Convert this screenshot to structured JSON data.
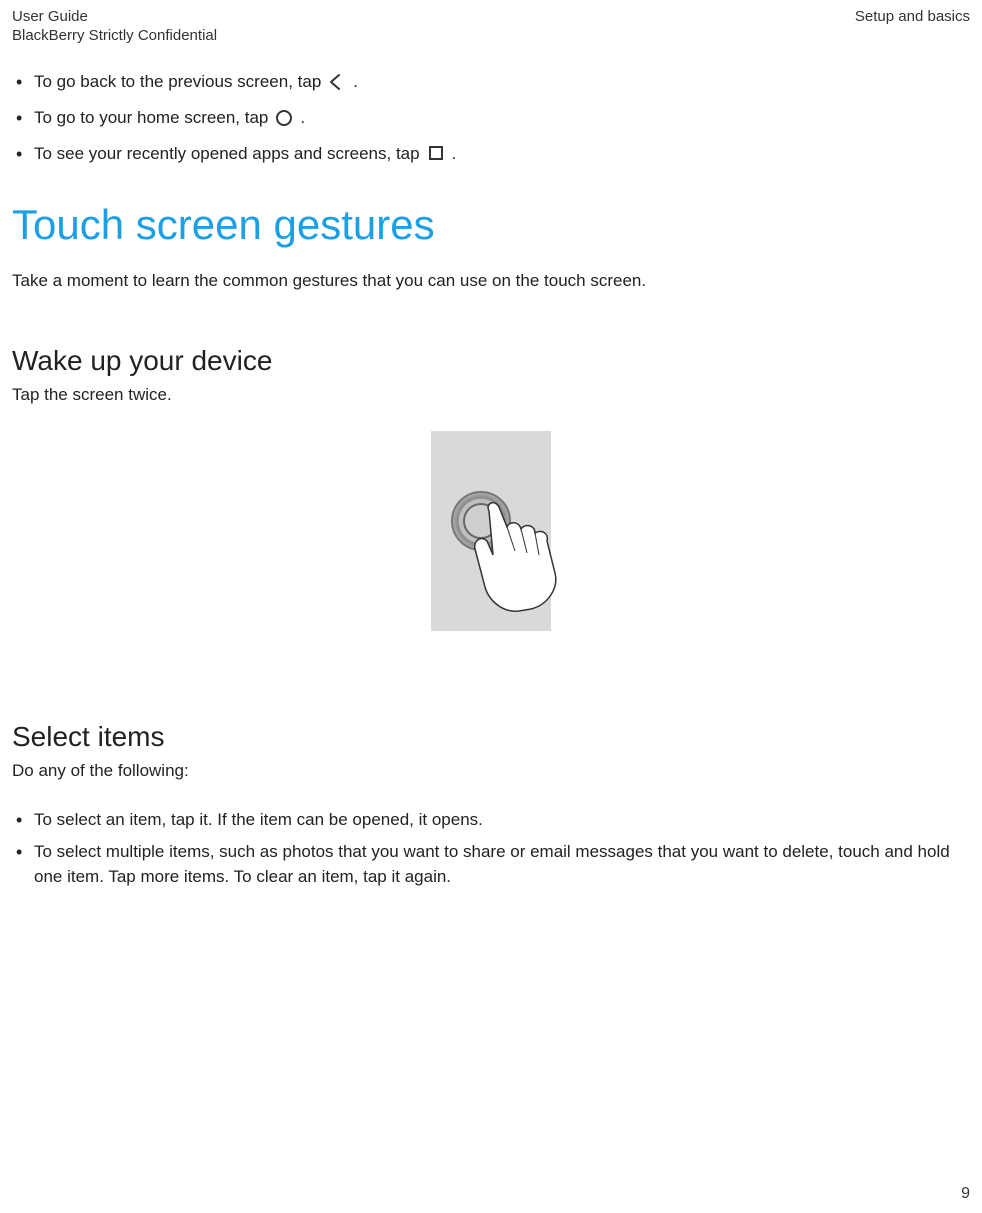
{
  "header": {
    "left_line1": "User Guide",
    "left_line2": "BlackBerry Strictly Confidential",
    "right": "Setup and basics"
  },
  "nav_bullets": {
    "back": {
      "pre": "To go back to the previous screen, tap ",
      "post": " ."
    },
    "home": {
      "pre": "To go to your home screen, tap ",
      "post": " ."
    },
    "recent": {
      "pre": "To see your recently opened apps and screens, tap ",
      "post": " ."
    }
  },
  "title": "Touch screen gestures",
  "lead": "Take a moment to learn the common gestures that you can use on the touch screen.",
  "wake": {
    "heading": "Wake up your device",
    "text": "Tap the screen twice."
  },
  "select": {
    "heading": "Select items",
    "intro": "Do any of the following:",
    "bullets": [
      "To select an item, tap it. If the item can be opened, it opens.",
      "To select multiple items, such as photos that you want to share or email messages that you want to delete, touch and hold one item. Tap more items. To clear an item, tap it again."
    ]
  },
  "page_number": "9"
}
